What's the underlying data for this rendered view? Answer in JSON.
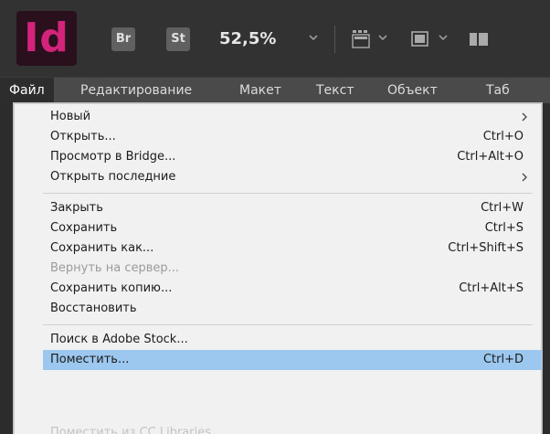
{
  "app": {
    "logo_text": "Id",
    "bridge_badge": "Br",
    "stock_badge": "St",
    "zoom_level": "52,5%"
  },
  "menubar": {
    "items": [
      {
        "label": "Файл"
      },
      {
        "label": "Редактирование"
      },
      {
        "label": "Макет"
      },
      {
        "label": "Текст"
      },
      {
        "label": "Объект"
      },
      {
        "label": "Таб"
      }
    ]
  },
  "file_menu": {
    "items": [
      {
        "label": "Новый",
        "submenu": true
      },
      {
        "label": "Открыть...",
        "shortcut": "Ctrl+O"
      },
      {
        "label": "Просмотр в Bridge...",
        "shortcut": "Ctrl+Alt+O"
      },
      {
        "label": "Открыть последние",
        "submenu": true
      },
      {
        "label": "Закрыть",
        "shortcut": "Ctrl+W"
      },
      {
        "label": "Сохранить",
        "shortcut": "Ctrl+S"
      },
      {
        "label": "Сохранить как...",
        "shortcut": "Ctrl+Shift+S"
      },
      {
        "label": "Вернуть на сервер...",
        "disabled": true
      },
      {
        "label": "Сохранить копию...",
        "shortcut": "Ctrl+Alt+S"
      },
      {
        "label": "Восстановить"
      },
      {
        "label": "Поиск в Adobe Stock..."
      },
      {
        "label": "Поместить...",
        "shortcut": "Ctrl+D",
        "highlighted": true
      },
      {
        "label": "Поместить из CC Libraries..."
      }
    ]
  },
  "colors": {
    "highlight": "#9cc7ee",
    "menu_bg": "#f1f1f1",
    "app_bar": "#323232",
    "indesign_pink": "#d4237a"
  }
}
